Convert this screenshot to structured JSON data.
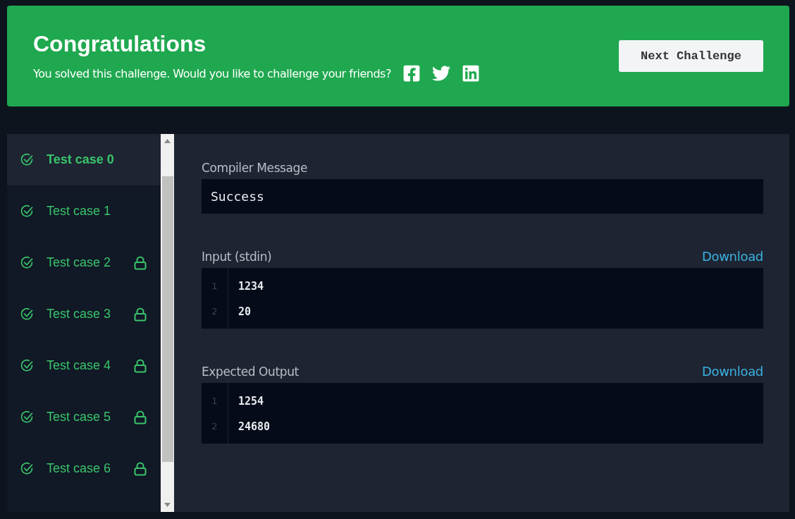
{
  "banner": {
    "title": "Congratulations",
    "message": "You solved this challenge. Would you like to challenge your friends?",
    "button": "Next Challenge"
  },
  "test_cases": [
    {
      "label": "Test case 0",
      "selected": true,
      "passed": true,
      "locked": false
    },
    {
      "label": "Test case 1",
      "selected": false,
      "passed": true,
      "locked": false
    },
    {
      "label": "Test case 2",
      "selected": false,
      "passed": true,
      "locked": true
    },
    {
      "label": "Test case 3",
      "selected": false,
      "passed": true,
      "locked": true
    },
    {
      "label": "Test case 4",
      "selected": false,
      "passed": true,
      "locked": true
    },
    {
      "label": "Test case 5",
      "selected": false,
      "passed": true,
      "locked": true
    },
    {
      "label": "Test case 6",
      "selected": false,
      "passed": true,
      "locked": true
    }
  ],
  "compiler": {
    "label": "Compiler Message",
    "message": "Success"
  },
  "sections": [
    {
      "label": "Input (stdin)",
      "download": "Download",
      "lines": [
        {
          "number": "1",
          "text": "1234"
        },
        {
          "number": "2",
          "text": "20"
        }
      ]
    },
    {
      "label": "Expected Output",
      "download": "Download",
      "lines": [
        {
          "number": "1",
          "text": "1254"
        },
        {
          "number": "2",
          "text": "24680"
        }
      ]
    }
  ]
}
